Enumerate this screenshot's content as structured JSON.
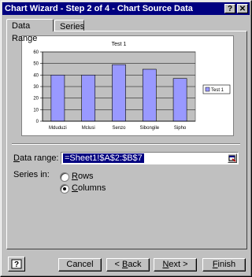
{
  "window": {
    "title": "Chart Wizard - Step 2 of 4 - Chart Source Data",
    "help_glyph": "?",
    "close_glyph": "✕"
  },
  "tabs": [
    {
      "label": "Data Range",
      "active": true
    },
    {
      "label": "Series",
      "active": false
    }
  ],
  "chart_data": {
    "type": "bar",
    "title": "Test 1",
    "categories": [
      "Mduduzi",
      "Mclusi",
      "Senzo",
      "Sibongile",
      "Sipho"
    ],
    "series": [
      {
        "name": "Test 1",
        "values": [
          40,
          40,
          49,
          45,
          37
        ],
        "color": "#9999ff"
      }
    ],
    "ylim": [
      0,
      60
    ],
    "yticks": [
      0,
      10,
      20,
      30,
      40,
      50,
      60
    ],
    "plot_area_color": "#c0c0c0",
    "grid": true,
    "legend": "right"
  },
  "data_range": {
    "label_prefix": "D",
    "label_rest": "ata range:",
    "value": "=Sheet1!$A$2:$B$7"
  },
  "series_in": {
    "label": "Series in:",
    "rows": {
      "u": "R",
      "rest": "ows",
      "checked": false
    },
    "columns": {
      "u": "C",
      "rest": "olumns",
      "checked": true
    }
  },
  "buttons": {
    "cancel": "Cancel",
    "back_u": "B",
    "back_pre": "< ",
    "back_rest": "ack",
    "next_u": "N",
    "next_rest": "ext >",
    "finish_u": "F",
    "finish_rest": "inish"
  }
}
